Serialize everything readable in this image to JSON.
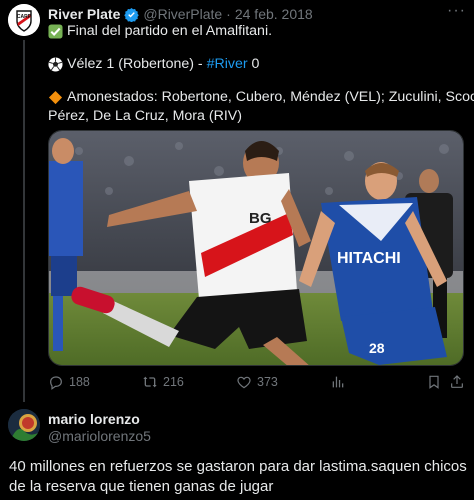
{
  "tweet": {
    "author_name": "River Plate",
    "author_handle": "@RiverPlate",
    "separator": "·",
    "date": "24 feb. 2018",
    "lines": {
      "l1": "Final del partido en el Amalfitani.",
      "l2_prefix": "Vélez 1 (Robertone) - ",
      "l2_hashtag": "#River",
      "l2_suffix": " 0",
      "l3": "Amonestados: Robertone, Cubero, Méndez (VEL); Zuculini, Scocco,",
      "l4": "Pérez, De La Cruz, Mora (RIV)"
    },
    "media": {
      "player_left_sponsor": "BG",
      "player_right_sponsor": "HITACHI",
      "player_right_number": "28"
    },
    "stats": {
      "replies": "188",
      "retweets": "216",
      "likes": "373"
    }
  },
  "reply": {
    "author_name": "mario lorenzo",
    "author_handle": "@mariolorenzo5",
    "text": "40 millones en refuerzos se gastaron para dar lastima.saquen chicos de la reserva que tienen ganas de jugar"
  },
  "colors": {
    "background": "#000000",
    "text": "#e7e9ea",
    "secondary": "#71767b",
    "accent": "#1d9bf0",
    "river_red": "#d7141a",
    "velez_blue": "#1f4ea8"
  },
  "icons": [
    "verified-badge-icon",
    "check-mark-emoji",
    "soccer-ball-emoji",
    "orange-diamond-emoji",
    "reply-icon",
    "retweet-icon",
    "like-icon",
    "views-icon",
    "bookmark-icon",
    "share-icon",
    "more-icon"
  ]
}
